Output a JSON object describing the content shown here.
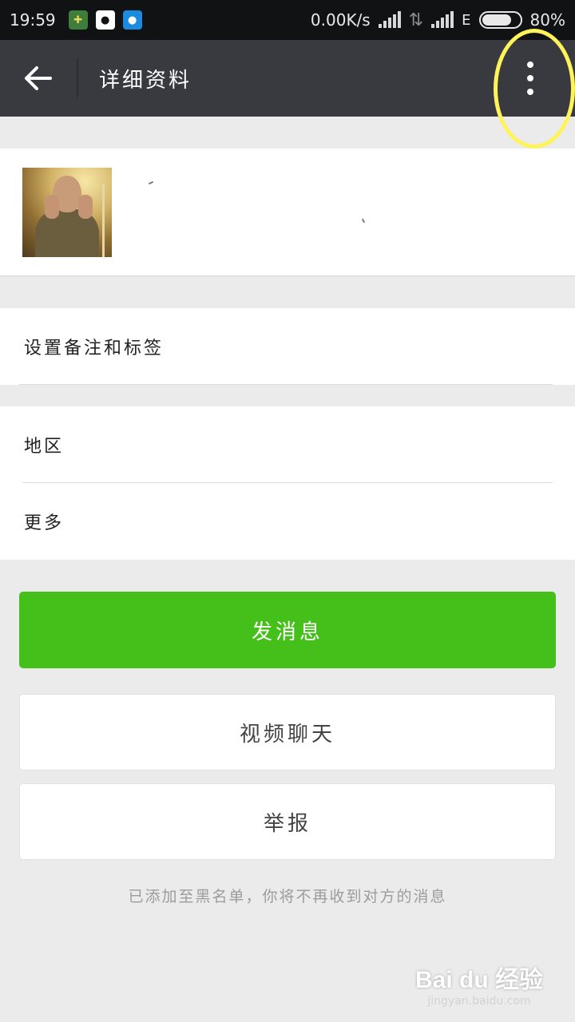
{
  "status_bar": {
    "time": "19:59",
    "net_speed": "0.00K/s",
    "network_type": "E",
    "battery": "80%",
    "battery_level": 0.8,
    "app_icons": [
      "shield-icon",
      "qq-icon",
      "water-drop-icon"
    ]
  },
  "app_bar": {
    "title": "详细资料",
    "back_icon": "arrow-left-icon",
    "more_icon": "vertical-dots-icon"
  },
  "menu": {
    "remark_tags": "设置备注和标签",
    "region": "地区",
    "more": "更多"
  },
  "actions": {
    "send_message": "发消息",
    "video_chat": "视频聊天",
    "report": "举报"
  },
  "notice": "已添加至黑名单，你将不再收到对方的消息",
  "watermark": {
    "main": "Bai du 经验",
    "sub": "jingyan.baidu.com"
  },
  "colors": {
    "app_bar": "#393a3f",
    "primary_button": "#45c01a",
    "highlight": "#fff35a",
    "background": "#ebebeb"
  }
}
